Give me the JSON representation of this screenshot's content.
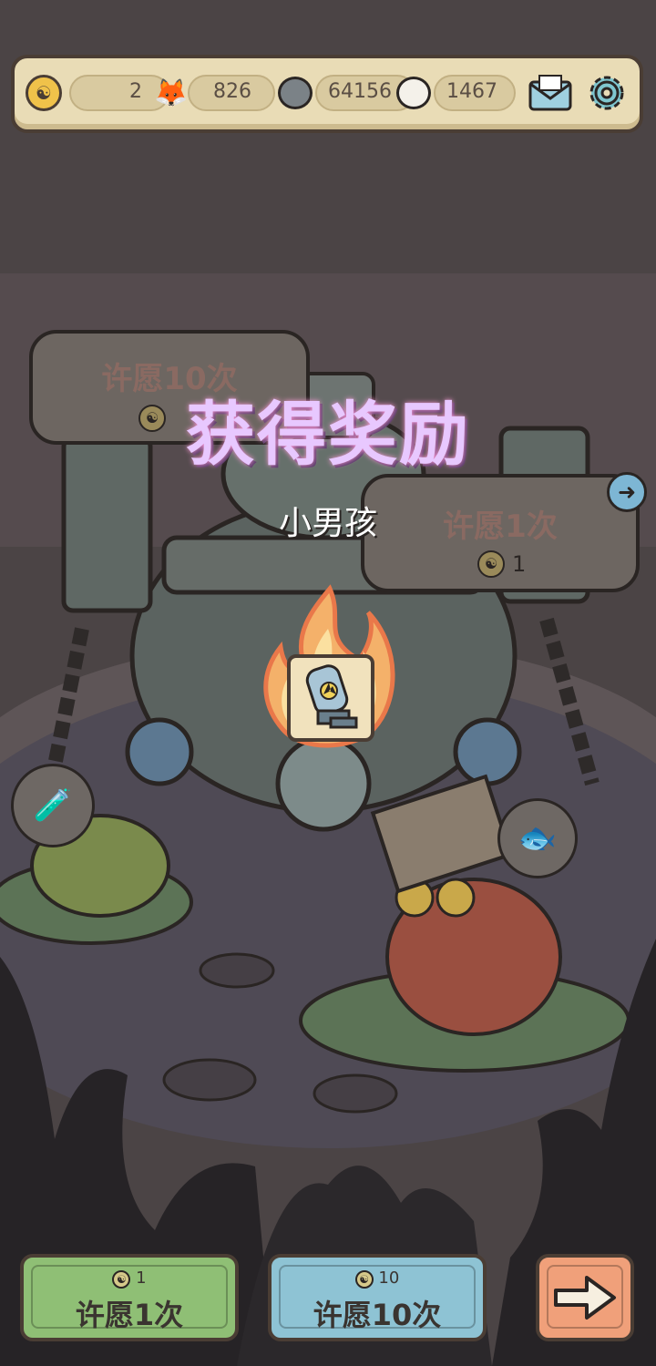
{
  "topbar": {
    "wish_coin_icon": "yin-yang-coin-icon",
    "wish_coins": "2",
    "fox_count": "826",
    "grey_spirit_count": "64156",
    "white_spirit_count": "1467",
    "mail_icon": "mail-icon",
    "settings_icon": "gear-icon"
  },
  "wish_bubbles": {
    "left": {
      "label": "许愿10次"
    },
    "right": {
      "label": "许愿1次",
      "cost": "1"
    }
  },
  "reward": {
    "title": "获得奖励",
    "item_name": "小男孩",
    "item_icon": "bomb-icon"
  },
  "buttons": {
    "wish_once": {
      "cost": "1",
      "label": "许愿1次"
    },
    "wish_ten": {
      "cost": "10",
      "label": "许愿10次"
    },
    "next_icon": "arrow-right-icon"
  },
  "colors": {
    "green_button": "#8fbf75",
    "blue_button": "#8ec3d4",
    "orange_button": "#f0a07a",
    "topbar": "#e9dcb6"
  }
}
